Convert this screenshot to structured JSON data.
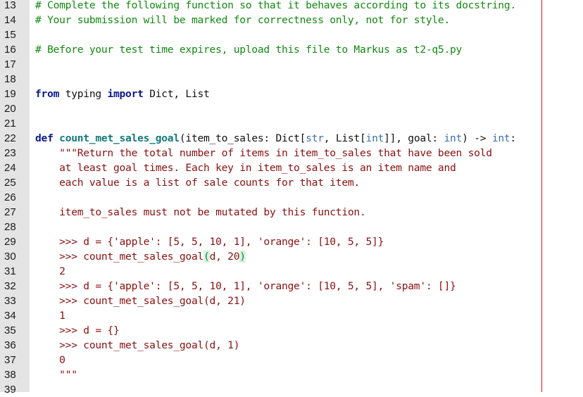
{
  "editor": {
    "lines": [
      {
        "n": "13",
        "segs": [
          {
            "t": "# Complete the following function so that it behaves according to its docstring.",
            "c": "cm"
          }
        ]
      },
      {
        "n": "14",
        "segs": [
          {
            "t": "# Your submission will be marked for correctness only, not for style.",
            "c": "cm"
          }
        ]
      },
      {
        "n": "15",
        "segs": []
      },
      {
        "n": "16",
        "segs": [
          {
            "t": "# Before your test time expires, upload this file to Markus as t2-q5.py",
            "c": "cm"
          }
        ]
      },
      {
        "n": "17",
        "segs": []
      },
      {
        "n": "18",
        "segs": []
      },
      {
        "n": "19",
        "segs": [
          {
            "t": "from",
            "c": "kw"
          },
          {
            "t": " typing ",
            "c": "df"
          },
          {
            "t": "import",
            "c": "kw"
          },
          {
            "t": " Dict, List",
            "c": "df"
          }
        ]
      },
      {
        "n": "20",
        "segs": []
      },
      {
        "n": "21",
        "segs": []
      },
      {
        "n": "22",
        "segs": [
          {
            "t": "def",
            "c": "kw"
          },
          {
            "t": " ",
            "c": "df"
          },
          {
            "t": "count_met_sales_goal",
            "c": "fn"
          },
          {
            "t": "(item_to_sales: Dict[",
            "c": "df"
          },
          {
            "t": "str",
            "c": "ty"
          },
          {
            "t": ", List[",
            "c": "df"
          },
          {
            "t": "int",
            "c": "ty"
          },
          {
            "t": "]], goal: ",
            "c": "df"
          },
          {
            "t": "int",
            "c": "ty"
          },
          {
            "t": ") -> ",
            "c": "df"
          },
          {
            "t": "int",
            "c": "ty"
          },
          {
            "t": ":",
            "c": "df"
          }
        ]
      },
      {
        "n": "23",
        "segs": [
          {
            "t": "    \"\"\"Return the total number of items in item_to_sales that have been sold",
            "c": "st"
          }
        ]
      },
      {
        "n": "24",
        "segs": [
          {
            "t": "    at least goal times. Each key in item_to_sales is an item name and",
            "c": "st"
          }
        ]
      },
      {
        "n": "25",
        "segs": [
          {
            "t": "    each value is a list of sale counts for that item.",
            "c": "st"
          }
        ]
      },
      {
        "n": "26",
        "segs": []
      },
      {
        "n": "27",
        "segs": [
          {
            "t": "    item_to_sales must not be mutated by this function.",
            "c": "st"
          }
        ]
      },
      {
        "n": "28",
        "segs": []
      },
      {
        "n": "29",
        "segs": [
          {
            "t": "    >>> d = {'apple': [5, 5, 10, 1], 'orange': [10, 5, 5]}",
            "c": "st"
          }
        ]
      },
      {
        "n": "30",
        "segs": [
          {
            "t": "    >>> count_met_sales_goal",
            "c": "st"
          },
          {
            "t": "(",
            "c": "hl"
          },
          {
            "t": "d, 20",
            "c": "st"
          },
          {
            "t": ")",
            "c": "hl"
          }
        ]
      },
      {
        "n": "31",
        "segs": [
          {
            "t": "    2",
            "c": "st"
          }
        ]
      },
      {
        "n": "32",
        "segs": [
          {
            "t": "    >>> d = {'apple': [5, 5, 10, 1], 'orange': [10, 5, 5], 'spam': []}",
            "c": "st"
          }
        ]
      },
      {
        "n": "33",
        "segs": [
          {
            "t": "    >>> count_met_sales_goal(d, 21)",
            "c": "st"
          }
        ]
      },
      {
        "n": "34",
        "segs": [
          {
            "t": "    1",
            "c": "st"
          }
        ]
      },
      {
        "n": "35",
        "segs": [
          {
            "t": "    >>> d = {}",
            "c": "st"
          }
        ]
      },
      {
        "n": "36",
        "segs": [
          {
            "t": "    >>> count_met_sales_goal(d, 1)",
            "c": "st"
          }
        ]
      },
      {
        "n": "37",
        "segs": [
          {
            "t": "    0",
            "c": "st"
          }
        ]
      },
      {
        "n": "38",
        "segs": [
          {
            "t": "    \"\"\"",
            "c": "st"
          }
        ]
      },
      {
        "n": "39",
        "segs": []
      }
    ]
  },
  "colors": {
    "comment": "#128a12",
    "keyword": "#0b1a8a",
    "function": "#137a7a",
    "type": "#3d6fae",
    "string": "#8a1010",
    "gutter": "#e4e4e4",
    "margin_line": "#e01818",
    "bracket_highlight": "#d6f5d6"
  }
}
